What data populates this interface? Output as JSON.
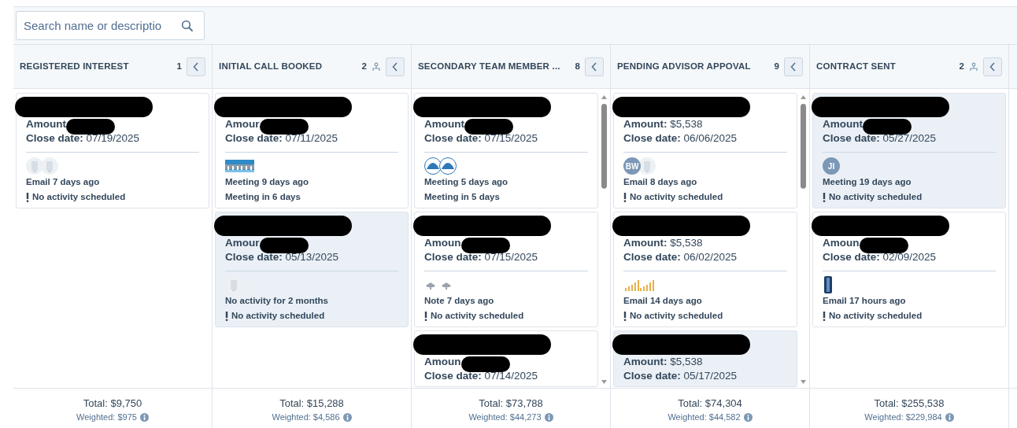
{
  "search": {
    "placeholder": "Search name or descriptio"
  },
  "columns": [
    {
      "title": "REGISTERED INTEREST",
      "count": "1",
      "owner_icon": false,
      "scrollable": false,
      "total": "Total: $9,750",
      "weighted": "Weighted: $975",
      "cards": [
        {
          "highlighted": false,
          "amount_label": "Amount",
          "close_label": "Close date:",
          "close_date": "07/19/2025",
          "avatars": [
            {
              "kind": "building"
            },
            {
              "kind": "building"
            }
          ],
          "activity": "Email 7 days ago",
          "next": "No activity scheduled",
          "next_warning": true
        }
      ]
    },
    {
      "title": "INITIAL CALL BOOKED",
      "count": "2",
      "owner_icon": true,
      "scrollable": false,
      "total": "Total: $15,288",
      "weighted": "Weighted: $4,586",
      "cards": [
        {
          "highlighted": false,
          "amount_label": "Amour",
          "close_label": "Close date:",
          "close_date": "07/11/2025",
          "avatars": [
            {
              "kind": "bridge"
            },
            {
              "kind": "bridge"
            }
          ],
          "activity": "Meeting 9 days ago",
          "next": "Meeting in 6 days",
          "next_warning": false
        },
        {
          "highlighted": true,
          "amount_label": "Amour",
          "close_label": "Close date:",
          "close_date": "05/13/2025",
          "avatars": [
            {
              "kind": "building"
            }
          ],
          "activity": "No activity for 2 months",
          "next": "No activity scheduled",
          "next_warning": true
        }
      ]
    },
    {
      "title": "SECONDARY TEAM MEMBER ...",
      "count": "8",
      "owner_icon": false,
      "scrollable": true,
      "total": "Total: $73,788",
      "weighted": "Weighted: $44,273",
      "cards": [
        {
          "highlighted": false,
          "amount_label": "Amount",
          "close_label": "Close date:",
          "close_date": "07/15/2025",
          "avatars": [
            {
              "kind": "wave"
            },
            {
              "kind": "wave"
            }
          ],
          "activity": "Meeting 5 days ago",
          "next": "Meeting in 5 days",
          "next_warning": false
        },
        {
          "highlighted": false,
          "amount_label": "Amoun",
          "close_label": "Close date:",
          "close_date": "07/15/2025",
          "avatars": [
            {
              "kind": "sketch"
            },
            {
              "kind": "sketch"
            }
          ],
          "activity": "Note 7 days ago",
          "next": "No activity scheduled",
          "next_warning": true
        },
        {
          "highlighted": false,
          "amount_label": "Amoun",
          "close_label": "Close date:",
          "close_date": "07/14/2025"
        }
      ]
    },
    {
      "title": "PENDING ADVISOR APPOVAL",
      "count": "9",
      "owner_icon": false,
      "scrollable": true,
      "total": "Total: $74,304",
      "weighted": "Weighted: $44,582",
      "cards": [
        {
          "highlighted": false,
          "amount_label": "Amount:",
          "amount": "$5,538",
          "close_label": "Close date:",
          "close_date": "06/06/2025",
          "avatars": [
            {
              "kind": "initials",
              "text": "BW"
            },
            {
              "kind": "building"
            }
          ],
          "activity": "Email 8 days ago",
          "next": "No activity scheduled",
          "next_warning": true
        },
        {
          "highlighted": false,
          "amount_label": "Amount:",
          "amount": "$5,538",
          "close_label": "Close date:",
          "close_date": "06/02/2025",
          "avatars": [
            {
              "kind": "chart"
            },
            {
              "kind": "chart"
            }
          ],
          "activity": "Email 14 days ago",
          "next": "No activity scheduled",
          "next_warning": true
        },
        {
          "highlighted": true,
          "amount_label": "Amount:",
          "amount": "$5,538",
          "close_label": "Close date:",
          "close_date": "05/17/2025"
        }
      ]
    },
    {
      "title": "CONTRACT SENT",
      "count": "2",
      "owner_icon": true,
      "scrollable": false,
      "total": "Total: $255,538",
      "weighted": "Weighted: $229,984",
      "cards": [
        {
          "highlighted": true,
          "amount_label": "Amount",
          "close_label": "Close date:",
          "close_date": "05/27/2025",
          "avatars": [
            {
              "kind": "initials",
              "text": "JI"
            }
          ],
          "activity": "Meeting 19 days ago",
          "next": "No activity scheduled",
          "next_warning": true
        },
        {
          "highlighted": false,
          "amount_label": "Amoun",
          "close_label": "Close date:",
          "close_date": "02/09/2025",
          "avatars": [
            {
              "kind": "tower"
            }
          ],
          "activity": "Email 17 hours ago",
          "next": "No activity scheduled",
          "next_warning": true
        }
      ]
    }
  ]
}
